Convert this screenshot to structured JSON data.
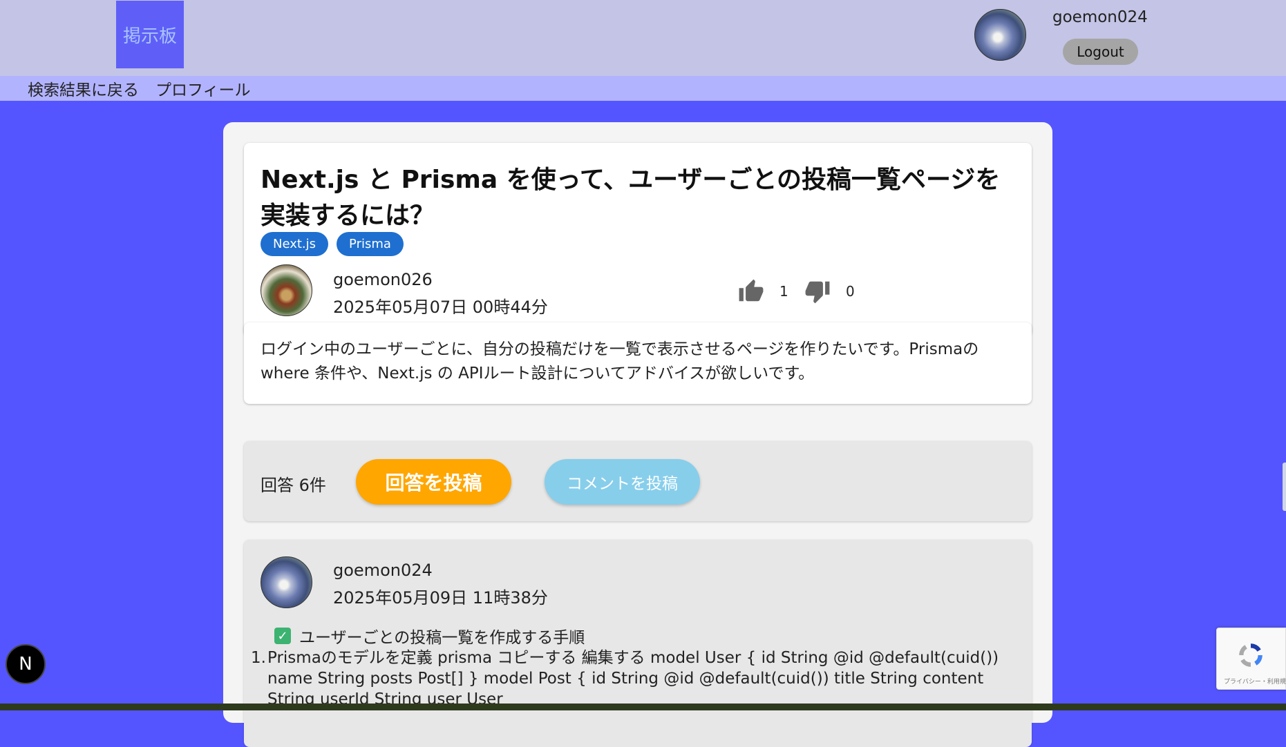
{
  "header": {
    "logo_text": "掲示板",
    "username": "goemon024",
    "logout_label": "Logout"
  },
  "nav": {
    "items": [
      {
        "label": "検索結果に戻る"
      },
      {
        "label": "プロフィール"
      }
    ]
  },
  "post": {
    "title": "Next.js と Prisma を使って、ユーザーごとの投稿一覧ページを実装するには？",
    "tags": [
      "Next.js",
      "Prisma"
    ],
    "author": "goemon026",
    "date": "2025年05月07日 00時44分",
    "likes": "1",
    "dislikes": "0",
    "body": "ログイン中のユーザーごとに、自分の投稿だけを一覧で表示させるページを作りたいです。Prismaの where 条件や、Next.js の APIルート設計についてアドバイスが欲しいです。"
  },
  "answers_bar": {
    "count_label": "回答 6件",
    "post_answer_label": "回答を投稿",
    "post_comment_label": "コメントを投稿"
  },
  "answer": {
    "author": "goemon024",
    "date": "2025年05月09日 11時38分",
    "heading": "ユーザーごとの投稿一覧を作成する手順",
    "item_number": "1.",
    "item_text": "Prismaのモデルを定義 prisma コピーする 編集する model User { id String @id @default(cuid()) name String posts Post[] } model Post { id String @id @default(cuid()) title String content String userId String user User"
  },
  "widgets": {
    "next_badge": "N",
    "recaptcha_text": "プライバシー・利用規約"
  },
  "colors": {
    "page_bg": "#5555ff",
    "header_bg": "#c3c4e6",
    "nav_bg": "#b2b3ff",
    "tag_bg": "#1f6fd0",
    "answer_button": "#ffa600",
    "comment_button": "#87ceeb"
  },
  "icons": {
    "like": "thumbs-up-icon",
    "dislike": "thumbs-down-icon",
    "check": "check-icon"
  }
}
